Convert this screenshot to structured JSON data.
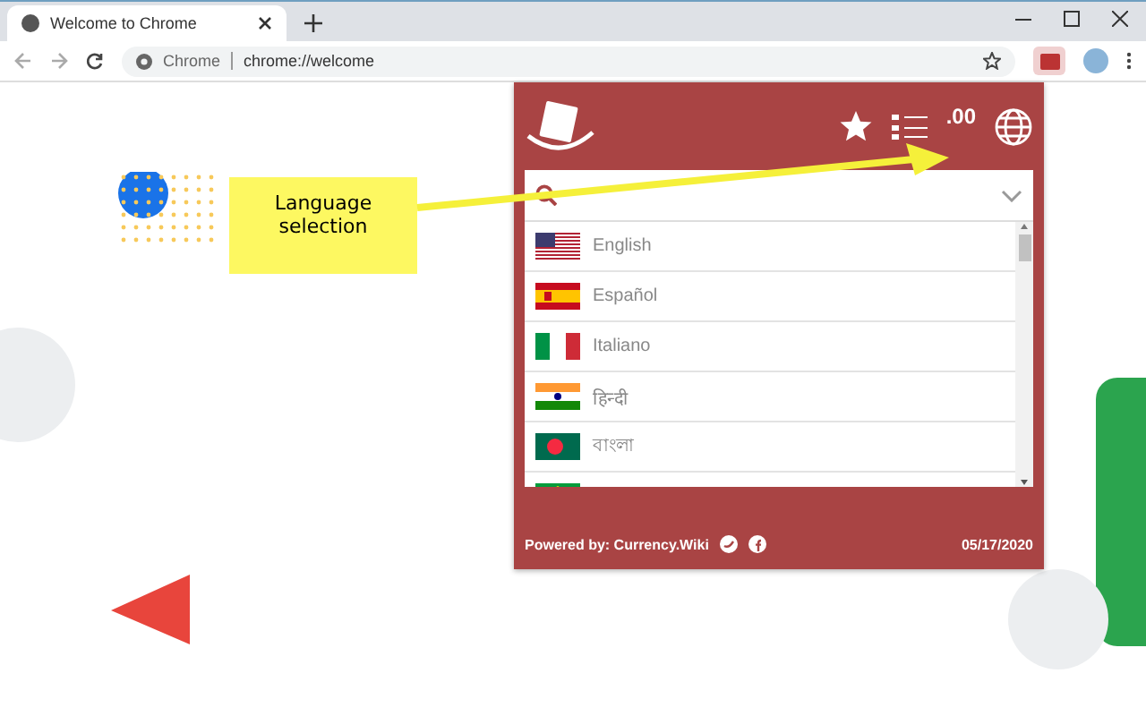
{
  "browser": {
    "tab_title": "Welcome to Chrome",
    "site_label": "Chrome",
    "url": "chrome://welcome"
  },
  "callout": {
    "text": "Language selection"
  },
  "popup": {
    "decimals_label": ".00",
    "languages": [
      {
        "name": "English",
        "kind": "us"
      },
      {
        "name": "Español",
        "kind": "es"
      },
      {
        "name": "Italiano",
        "kind": "it"
      },
      {
        "name": "हिन्दी",
        "kind": "in"
      },
      {
        "name": "বাংলা",
        "kind": "bd"
      },
      {
        "kind": "br"
      }
    ],
    "footer": {
      "powered_by": "Powered by: Currency.Wiki",
      "date": "05/17/2020"
    }
  }
}
